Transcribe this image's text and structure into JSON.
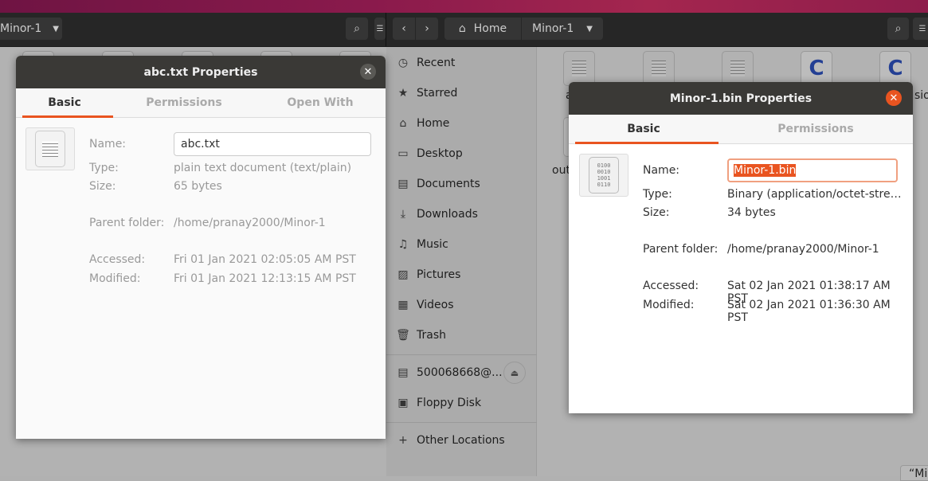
{
  "left_window": {
    "path_current": "Minor-1"
  },
  "right_window": {
    "path": [
      "Home",
      "Minor-1"
    ],
    "sidebar": [
      {
        "icon": "clock-icon",
        "label": "Recent"
      },
      {
        "icon": "star-icon",
        "label": "Starred"
      },
      {
        "icon": "home-icon",
        "label": "Home"
      },
      {
        "icon": "desktop-icon",
        "label": "Desktop"
      },
      {
        "icon": "document-icon",
        "label": "Documents"
      },
      {
        "icon": "download-icon",
        "label": "Downloads"
      },
      {
        "icon": "music-icon",
        "label": "Music"
      },
      {
        "icon": "pictures-icon",
        "label": "Pictures"
      },
      {
        "icon": "video-icon",
        "label": "Videos"
      },
      {
        "icon": "trash-icon",
        "label": "Trash"
      }
    ],
    "devices": [
      {
        "icon": "server-icon",
        "label": "500068668@..."
      },
      {
        "icon": "floppy-icon",
        "label": "Floppy Disk"
      }
    ],
    "other": "Other Locations",
    "file_labels": [
      "a",
      "sio",
      "out"
    ],
    "status": "“Mi"
  },
  "abc_dialog": {
    "title": "abc.txt Properties",
    "tabs": [
      "Basic",
      "Permissions",
      "Open With"
    ],
    "fields": {
      "name_label": "Name:",
      "name": "abc.txt",
      "type_label": "Type:",
      "type": "plain text document (text/plain)",
      "size_label": "Size:",
      "size": "65 bytes",
      "parent_label": "Parent folder:",
      "parent": "/home/pranay2000/Minor-1",
      "accessed_label": "Accessed:",
      "accessed": "Fri 01 Jan 2021 02:05:05 AM PST",
      "modified_label": "Modified:",
      "modified": "Fri 01 Jan 2021 12:13:15 AM PST"
    }
  },
  "bin_dialog": {
    "title": "Minor-1.bin Properties",
    "tabs": [
      "Basic",
      "Permissions"
    ],
    "bin_icon_text": "0100 0010 1001 0110",
    "fields": {
      "name_label": "Name:",
      "name": "Minor-1.bin",
      "type_label": "Type:",
      "type": "Binary (application/octet-stre…",
      "size_label": "Size:",
      "size": "34 bytes",
      "parent_label": "Parent folder:",
      "parent": "/home/pranay2000/Minor-1",
      "accessed_label": "Accessed:",
      "accessed": "Sat 02 Jan 2021 01:38:17 AM PST",
      "modified_label": "Modified:",
      "modified": "Sat 02 Jan 2021 01:36:30 AM PST"
    }
  },
  "colors": {
    "accent": "#e95420",
    "header": "#3a3936"
  }
}
